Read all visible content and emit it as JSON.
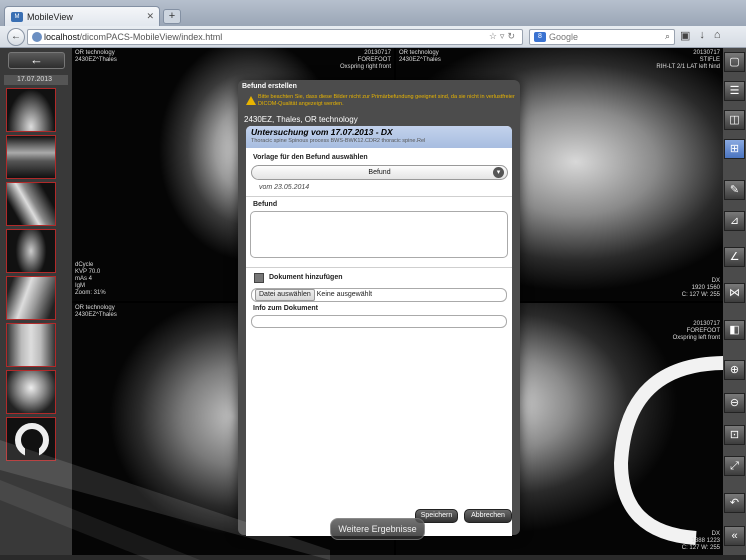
{
  "browser": {
    "tab_title": "MobileView",
    "new_tab": "+",
    "url_host": "localhost",
    "url_path": "/dicomPACS-MobileView/index.html",
    "search_placeholder": "Google"
  },
  "sidebar": {
    "back_label": "←",
    "study_date": "17.07.2013"
  },
  "panes": {
    "top_left": {
      "left_text": "OR technology\n2430EZ^Thales",
      "right_text": "20130717\nFOREFOOT\nOxspring right front",
      "bottom_text": "dCycle\nKVP 70.0\nmAs 4\nIgM\nZoom: 31%"
    },
    "top_right": {
      "left_text": "OR technology\n2430EZ^Thales",
      "right_text": "20130717\nSTIFLE\nRIH-LT 2/1 LAT left hind",
      "bottom_right": "DX\n1920 1560\nC: 127 W: 255"
    },
    "bottom_left": {
      "left_text": "OR technology\n2430EZ^Thales"
    },
    "bottom_right": {
      "right_text": "20130717\nFOREFOOT\nOxspring left front",
      "bottom_right": "DX\n1388 1223\nC: 127 W: 255"
    }
  },
  "dialog": {
    "title": "Befund erstellen",
    "warning": "Bitte beachten Sie, dass diese Bilder nicht zur Primärbefundung geeignet sind, da sie nicht in verlustfreier DICOM-Qualität angezeigt werden.",
    "patient": "2430EZ, Thales, OR technology",
    "study_title": "Untersuchung vom 17.07.2013 - DX",
    "study_desc": "Thoracic spine Spinous process BWS-BWK12.CDR2 thoracic spine.Rel",
    "template_label": "Vorlage für den Befund auswählen",
    "template_value": "Befund",
    "template_date": "vom 23.05.2014",
    "befund_label": "Befund",
    "befund_value": "",
    "add_doc_label": "Dokument hinzufügen",
    "file_button": "Datei auswählen",
    "file_status": "Keine ausgewählt",
    "doc_info_label": "Info zum Dokument",
    "doc_info_value": "",
    "save_label": "Speichern",
    "cancel_label": "Abbrechen"
  },
  "more_results_label": "Weitere Ergebnisse",
  "colors": {
    "accent_blue": "#a7bde0",
    "warning": "#e8b400",
    "thumb_border": "#b02a2a"
  }
}
